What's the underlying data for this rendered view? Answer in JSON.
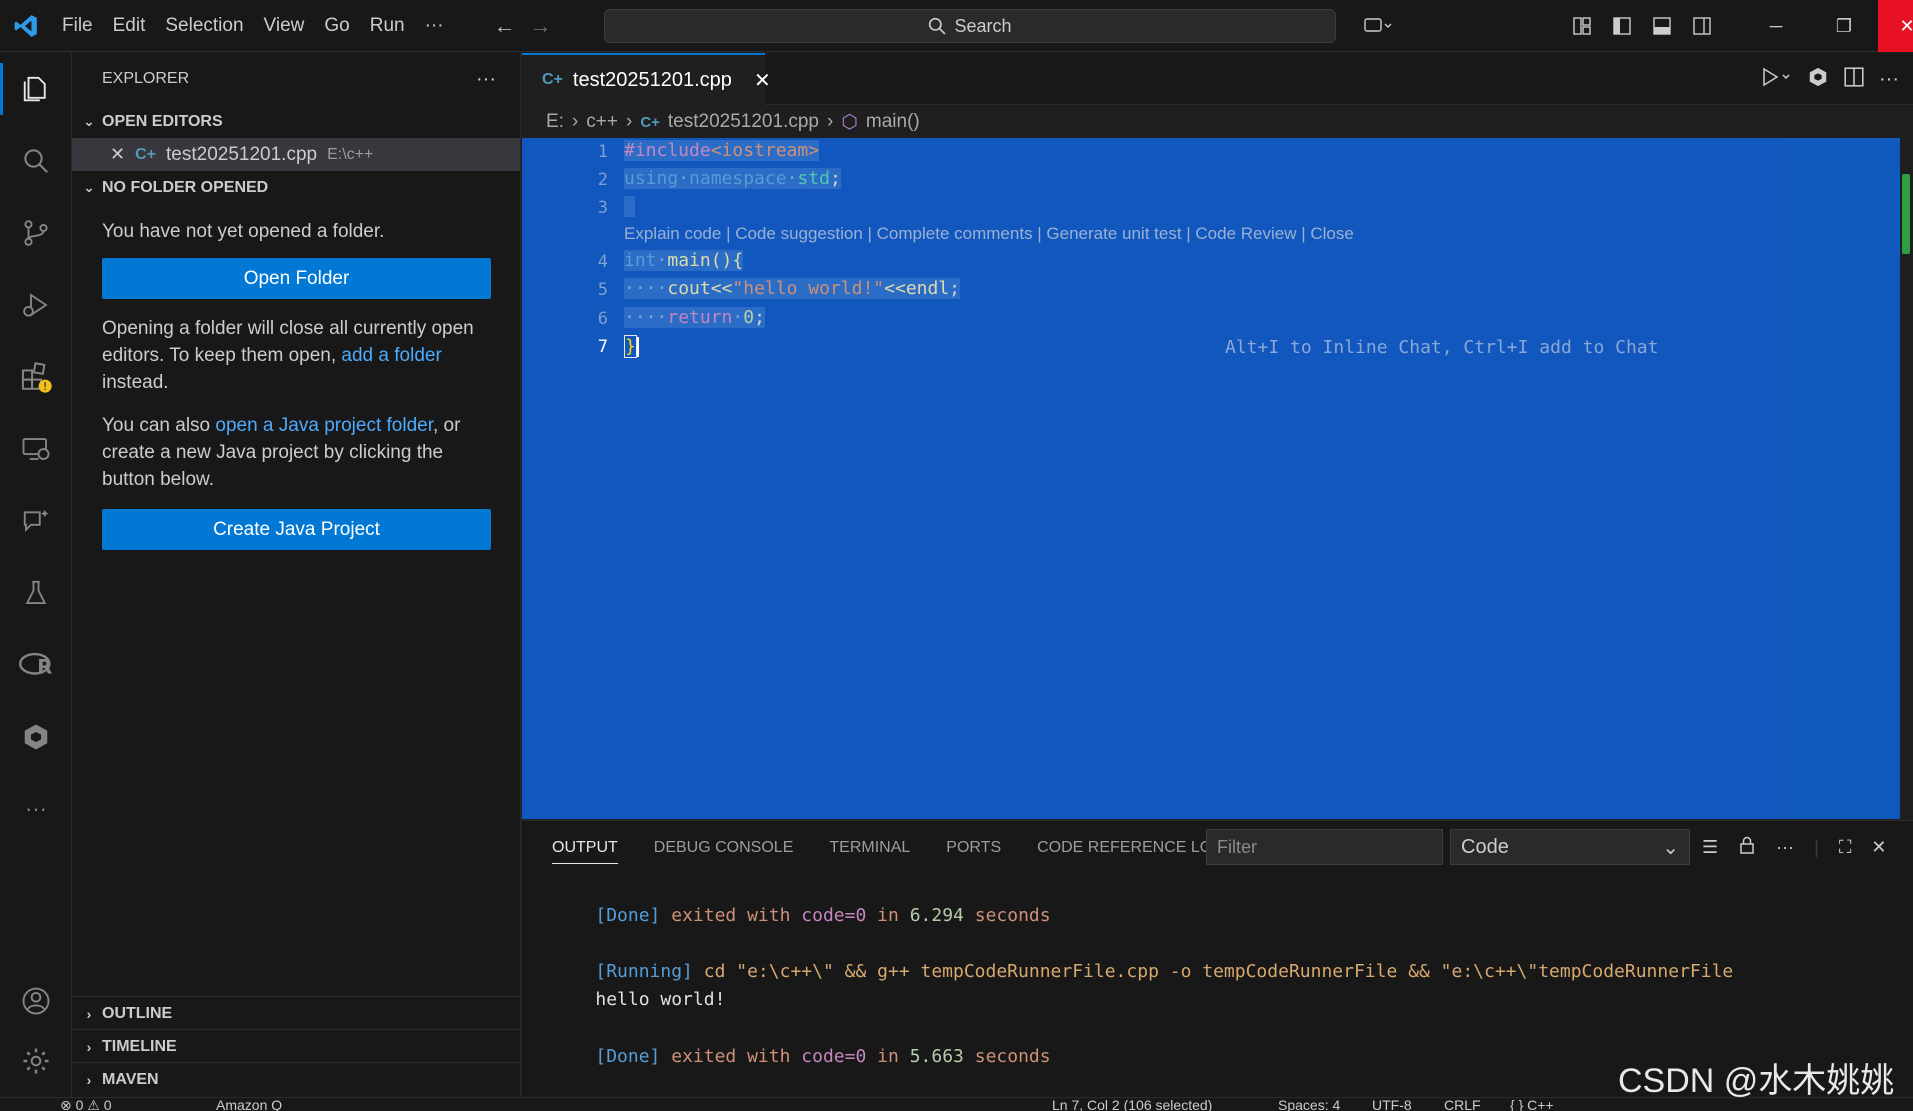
{
  "titlebar": {
    "menu": [
      "File",
      "Edit",
      "Selection",
      "View",
      "Go",
      "Run",
      "···"
    ],
    "search_label": "Search"
  },
  "sidebar": {
    "title": "EXPLORER",
    "more": "···",
    "open_editors_header": "OPEN EDITORS",
    "open_editor_file": "test20251201.cpp",
    "open_editor_path": "E:\\c++",
    "no_folder_header": "NO FOLDER OPENED",
    "no_folder_text": "You have not yet opened a folder.",
    "open_folder_button": "Open Folder",
    "opening_text_1": "Opening a folder will close all currently open editors. To keep them open,",
    "add_folder_link": "add a folder",
    "opening_text_2": "instead.",
    "java_text_1": "You can also",
    "java_link": "open a Java project folder",
    "java_text_2": ", or create a new Java project by clicking the button below.",
    "create_java_button": "Create Java Project",
    "outline": "OUTLINE",
    "timeline": "TIMELINE",
    "maven": "MAVEN"
  },
  "editor": {
    "tab_label": "test20251201.cpp",
    "breadcrumb": [
      "E:",
      "c++",
      "test20251201.cpp",
      "main()"
    ],
    "line_numbers": [
      "1",
      "2",
      "3",
      "4",
      "5",
      "6",
      "7"
    ],
    "code": {
      "l1_a": "#include",
      "l1_b": "<iostream>",
      "l2_a": "using",
      "l2_b": "namespace",
      "l2_c": "std",
      "l2_d": ";",
      "l4_a": "int",
      "l4_b": "main",
      "l4_c": "(){",
      "l5_indent": "····",
      "l5_a": "cout",
      "l5_b": "<<",
      "l5_c": "\"hello world!\"",
      "l5_d": "<<",
      "l5_e": "endl",
      "l5_f": ";",
      "l6_indent": "····",
      "l6_a": "return",
      "l6_b": "0",
      "l6_c": ";",
      "l7_a": "}"
    },
    "codelens": "Explain code | Code suggestion | Complete comments | Generate unit test | Code Review | Close",
    "ghost_hint": "Alt+I to Inline Chat, Ctrl+I add to Chat"
  },
  "panel": {
    "tabs": [
      "OUTPUT",
      "DEBUG CONSOLE",
      "TERMINAL",
      "PORTS",
      "CODE REFERENCE LOG"
    ],
    "filter_placeholder": "Filter",
    "channel": "Code",
    "output": {
      "done1_tag": "[Done]",
      "done1_text": "exited with",
      "done1_code": "code=0",
      "done1_in": "in",
      "done1_secs": "6.294",
      "done1_unit": "seconds",
      "running_tag": "[Running]",
      "running_cmd": "cd \"e:\\c++\\\" && g++ tempCodeRunnerFile.cpp -o tempCodeRunnerFile && \"e:\\c++\\\"tempCodeRunnerFile",
      "hello": "hello world!",
      "done2_tag": "[Done]",
      "done2_text": "exited with",
      "done2_code": "code=0",
      "done2_in": "in",
      "done2_secs": "5.663",
      "done2_unit": "seconds"
    }
  },
  "statusbar": {
    "problems": "⊗ 0 ⚠ 0",
    "amazon": "Amazon Q",
    "position": "Ln 7, Col 2 (106 selected)",
    "spaces": "Spaces: 4",
    "encoding": "UTF-8",
    "eol": "CRLF",
    "language": "{ } C++"
  },
  "watermark": "CSDN @水木姚姚"
}
